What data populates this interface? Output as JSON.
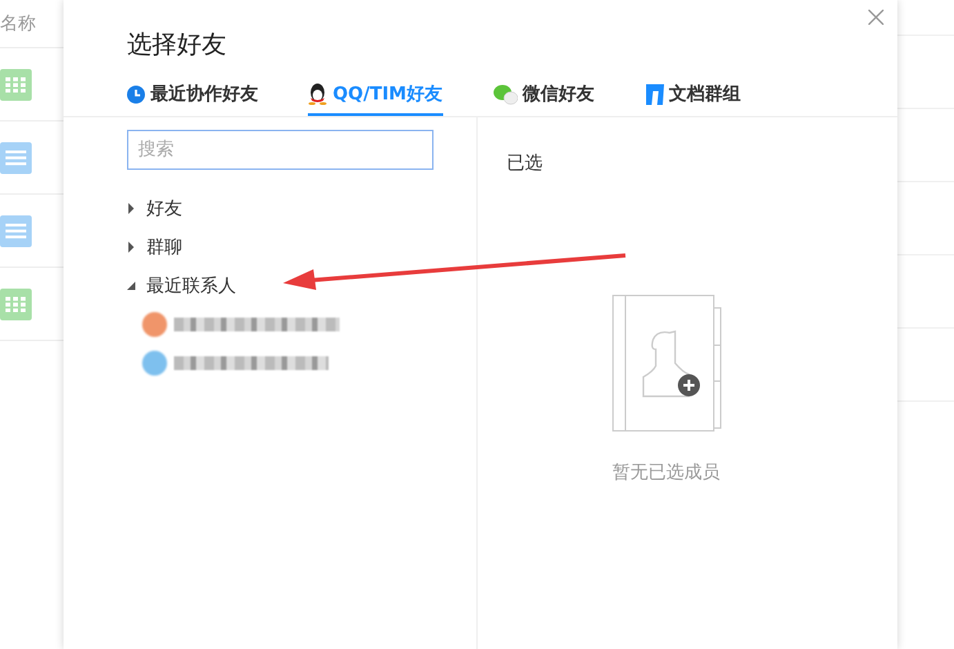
{
  "background_list": {
    "header": "名称",
    "rows": [
      {
        "kind": "grid"
      },
      {
        "kind": "list"
      },
      {
        "kind": "list"
      },
      {
        "kind": "grid"
      }
    ]
  },
  "dialog": {
    "title": "选择好友",
    "tabs": [
      {
        "label": "最近协作好友",
        "kind": "clock",
        "selected": false
      },
      {
        "label": "QQ/TIM好友",
        "kind": "penguin",
        "selected": true
      },
      {
        "label": "微信好友",
        "kind": "chat",
        "selected": false
      },
      {
        "label": "文档群组",
        "kind": "doc",
        "selected": false
      }
    ],
    "search": {
      "placeholder": "搜索"
    },
    "tree": [
      {
        "label": "好友",
        "expanded": false
      },
      {
        "label": "群聊",
        "expanded": false
      },
      {
        "label": "最近联系人",
        "expanded": true,
        "children": [
          {
            "kind": "blurred",
            "color": "#f0956a"
          },
          {
            "kind": "blurred",
            "color": "#7ec0ee"
          }
        ]
      }
    ],
    "selected_panel": {
      "title": "已选",
      "empty_text": "暂无已选成员"
    }
  }
}
